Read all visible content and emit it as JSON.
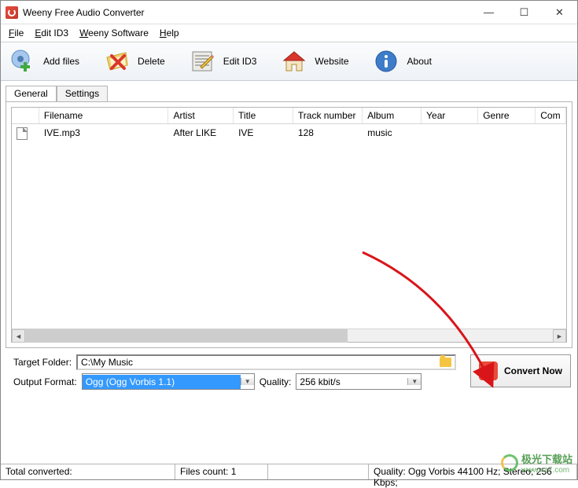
{
  "window": {
    "title": "Weeny Free Audio Converter",
    "controls": {
      "min": "—",
      "max": "☐",
      "close": "✕"
    }
  },
  "menubar": {
    "file": "File",
    "file_u": "F",
    "editid3": "Edit ID3",
    "editid3_u": "E",
    "weeny": "Weeny Software",
    "weeny_u": "W",
    "help": "Help",
    "help_u": "H"
  },
  "toolbar": {
    "addfiles": "Add files",
    "delete": "Delete",
    "editid3": "Edit ID3",
    "website": "Website",
    "about": "About"
  },
  "tabs": {
    "general": "General",
    "settings": "Settings"
  },
  "list": {
    "columns": [
      "",
      "Filename",
      "Artist",
      "Title",
      "Track number",
      "Album",
      "Year",
      "Genre",
      "Com"
    ],
    "rows": [
      {
        "filename": "IVE.mp3",
        "artist": "After LIKE",
        "title": "IVE",
        "track": "128",
        "album": "music",
        "year": "",
        "genre": "",
        "com": ""
      }
    ]
  },
  "target": {
    "label": "Target Folder:",
    "value": "C:\\My Music"
  },
  "output": {
    "format_label": "Output Format:",
    "format_value": "Ogg (Ogg Vorbis 1.1)",
    "quality_label": "Quality:",
    "quality_value": "256 kbit/s"
  },
  "convert": {
    "label": "Convert Now"
  },
  "status": {
    "total": "Total converted:",
    "files": "Files count: 1",
    "quality": "Quality: Ogg Vorbis 44100 Hz; Stereo; 256 Kbps;"
  },
  "watermark": {
    "text": "极光下载站",
    "url": "www.xz7.com"
  }
}
